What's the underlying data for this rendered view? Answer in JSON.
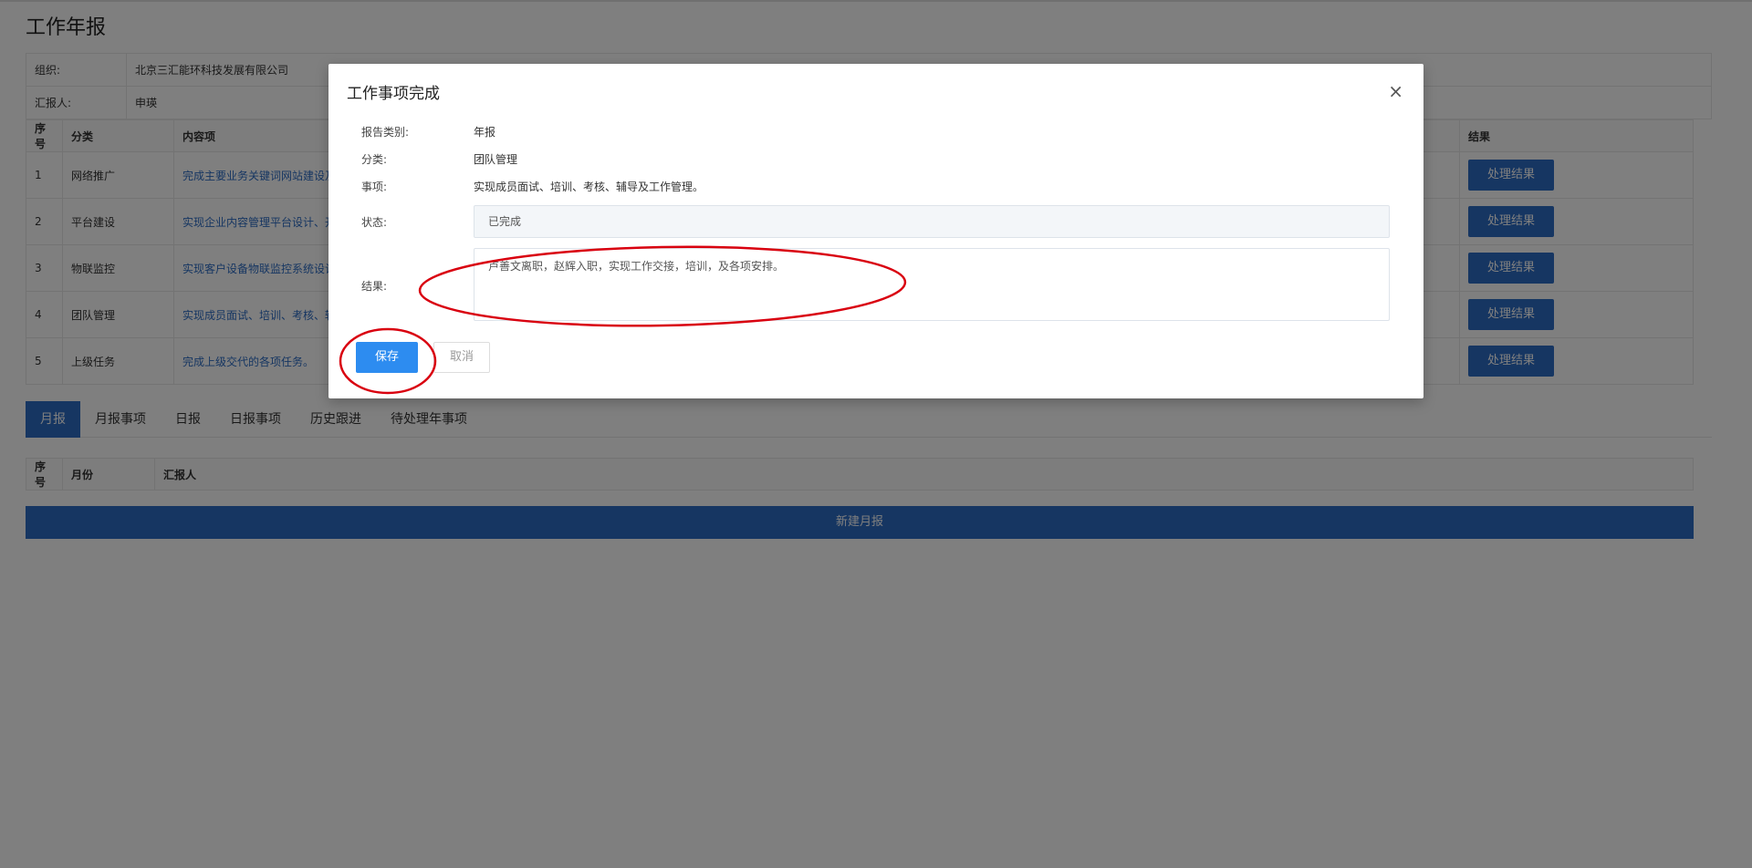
{
  "page": {
    "title": "工作年报",
    "info": {
      "org_label": "组织:",
      "org_value": "北京三汇能环科技发展有限公司",
      "reporter_label": "汇报人:",
      "reporter_value": "申瑛"
    },
    "table": {
      "headers": [
        "序号",
        "分类",
        "内容项",
        "结果"
      ],
      "rows": [
        {
          "no": "1",
          "category": "网络推广",
          "content": "完成主要业务关键词网站建设及"
        },
        {
          "no": "2",
          "category": "平台建设",
          "content": "实现企业内容管理平台设计、开"
        },
        {
          "no": "3",
          "category": "物联监控",
          "content": "实现客户设备物联监控系统设计"
        },
        {
          "no": "4",
          "category": "团队管理",
          "content": "实现成员面试、培训、考核、辅"
        },
        {
          "no": "5",
          "category": "上级任务",
          "content": "完成上级交代的各项任务。"
        }
      ],
      "action_label": "处理结果"
    },
    "tabs": [
      "月报",
      "月报事项",
      "日报",
      "日报事项",
      "历史跟进",
      "待处理年事项"
    ],
    "active_tab": 0,
    "month_table_headers": [
      "序号",
      "月份",
      "汇报人"
    ],
    "new_button": "新建月报"
  },
  "modal": {
    "title": "工作事项完成",
    "close_glyph": "×",
    "report_type_label": "报告类别:",
    "report_type_value": "年报",
    "category_label": "分类:",
    "category_value": "团队管理",
    "item_label": "事项:",
    "item_value": "实现成员面试、培训、考核、辅导及工作管理。",
    "status_label": "状态:",
    "status_value": "已完成",
    "result_label": "结果:",
    "result_value": "卢善文离职，赵辉入职，实现工作交接，培训，及各项安排。",
    "save_label": "保存",
    "cancel_label": "取消"
  },
  "colors": {
    "primary": "#2d6cc4",
    "save": "#2d8cf0",
    "annotation": "#d9000f"
  }
}
